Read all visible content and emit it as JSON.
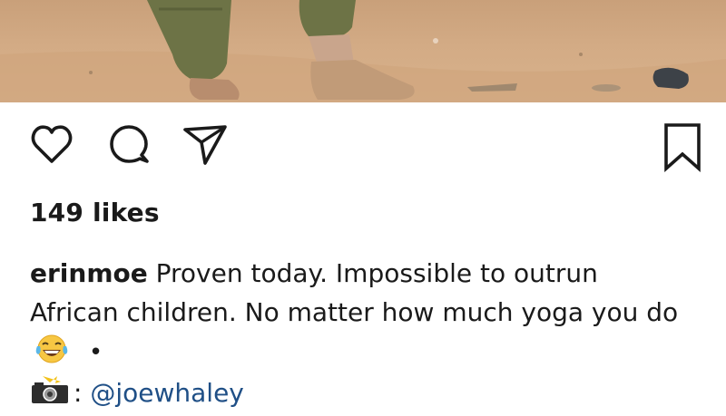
{
  "post": {
    "likes_text": "149 likes",
    "username": "erinmoe",
    "caption_text": "Proven today. Impossible to outrun African children. No matter how much yoga you do",
    "caption_separator": "•",
    "credit_colon": ":",
    "credit_mention": "@joewhaley"
  },
  "icons": {
    "like": "heart-icon",
    "comment": "comment-icon",
    "share": "send-icon",
    "save": "bookmark-icon",
    "emoji": "tears-of-joy-emoji",
    "credit": "camera-flash-icon"
  },
  "colors": {
    "text": "#1a1a1a",
    "mention": "#1f4f86",
    "sand": "#d3ab85"
  }
}
